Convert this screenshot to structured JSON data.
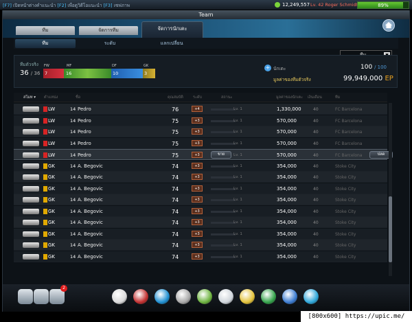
{
  "topbar": {
    "hint_k1": "[F7]",
    "hint_t1": "เปิดหน้าต่างคำแนะนำ",
    "hint_k2": "[F2]",
    "hint_t2": "เพื่อดูวิดีโอแนะนำ",
    "hint_k3": "[F3]",
    "hint_t3": "เซฟภาพ",
    "coins": "12,249,557",
    "level_name": "Lv. 42 Roger Schmidt",
    "progress_percent": 89,
    "progress_text": "89%"
  },
  "window": {
    "title": "Team"
  },
  "tabs": [
    {
      "label": "ทีม",
      "active": false
    },
    {
      "label": "จัดการทีม",
      "active": false
    },
    {
      "label": "จัดการนักเตะ",
      "active": true
    }
  ],
  "subtabs": [
    {
      "label": "ทีม",
      "active": true
    },
    {
      "label": "ระดับ",
      "active": false
    },
    {
      "label": "แลกเปลี่ยน",
      "active": false
    }
  ],
  "summary": {
    "label": "ทีมตัวจริง",
    "count": "36",
    "total": "/ 36",
    "fw_label": "FW",
    "fw": "7",
    "mf_label": "MF",
    "mf": "16",
    "df_label": "DF",
    "df": "10",
    "gk_label": "GK",
    "gk": "3",
    "capacity_label": "นักเตะ",
    "capacity": "100",
    "capacity_max": "/ 100",
    "value_label": "มูลค่าของทีมตัวจริง",
    "value": "99,949,000",
    "value_unit": "EP"
  },
  "filter": {
    "selected": "ทีม"
  },
  "columns": {
    "sort": "สโมท ▾",
    "position": "ตำแหน่ง",
    "name": "ชื่อ",
    "ovr": "คุณสมบัติ",
    "grade": "ระดับ",
    "status": "สถานะ",
    "price": "มูลค่าของนักเตะ",
    "salary": "เงินเดือน",
    "club": "ทีม"
  },
  "rows": [
    {
      "pos": "LW",
      "color": "#d72424",
      "num": "14",
      "name": "Pedro",
      "ovr": "76",
      "grade": "+4",
      "lv": "Lv. 1",
      "price": "1,330,000",
      "salary": "40",
      "club": "FC Barcelona",
      "sell": ""
    },
    {
      "pos": "LW",
      "color": "#d72424",
      "num": "14",
      "name": "Pedro",
      "ovr": "75",
      "grade": "+3",
      "lv": "Lv. 1",
      "price": "570,000",
      "salary": "40",
      "club": "FC Barcelona",
      "sell": ""
    },
    {
      "pos": "LW",
      "color": "#d72424",
      "num": "14",
      "name": "Pedro",
      "ovr": "75",
      "grade": "+3",
      "lv": "Lv. 1",
      "price": "570,000",
      "salary": "40",
      "club": "FC Barcelona",
      "sell": ""
    },
    {
      "pos": "LW",
      "color": "#d72424",
      "num": "14",
      "name": "Pedro",
      "ovr": "75",
      "grade": "+3",
      "lv": "Lv. 1",
      "price": "570,000",
      "salary": "40",
      "club": "FC Barcelona",
      "sell": ""
    },
    {
      "pos": "LW",
      "color": "#d72424",
      "num": "14",
      "name": "Pedro",
      "ovr": "75",
      "grade": "+3",
      "lv": "Lv. 1",
      "price": "570,000",
      "salary": "40",
      "club": "FC Barcelona",
      "sell": "ขาย",
      "release": "ปลด"
    },
    {
      "pos": "GK",
      "color": "#e0a800",
      "num": "14",
      "name": "A. Begovic",
      "ovr": "74",
      "grade": "+3",
      "lv": "Lv. 1",
      "price": "354,000",
      "salary": "40",
      "club": "Stoke City",
      "sell": ""
    },
    {
      "pos": "GK",
      "color": "#e0a800",
      "num": "14",
      "name": "A. Begovic",
      "ovr": "74",
      "grade": "+3",
      "lv": "Lv. 1",
      "price": "354,000",
      "salary": "40",
      "club": "Stoke City",
      "sell": ""
    },
    {
      "pos": "GK",
      "color": "#e0a800",
      "num": "14",
      "name": "A. Begovic",
      "ovr": "74",
      "grade": "+3",
      "lv": "Lv. 1",
      "price": "354,000",
      "salary": "40",
      "club": "Stoke City",
      "sell": ""
    },
    {
      "pos": "GK",
      "color": "#e0a800",
      "num": "14",
      "name": "A. Begovic",
      "ovr": "74",
      "grade": "+3",
      "lv": "Lv. 1",
      "price": "354,000",
      "salary": "40",
      "club": "Stoke City",
      "sell": ""
    },
    {
      "pos": "GK",
      "color": "#e0a800",
      "num": "14",
      "name": "A. Begovic",
      "ovr": "74",
      "grade": "+3",
      "lv": "Lv. 1",
      "price": "354,000",
      "salary": "40",
      "club": "Stoke City",
      "sell": ""
    },
    {
      "pos": "GK",
      "color": "#e0a800",
      "num": "14",
      "name": "A. Begovic",
      "ovr": "74",
      "grade": "+3",
      "lv": "Lv. 1",
      "price": "354,000",
      "salary": "40",
      "club": "Stoke City",
      "sell": ""
    },
    {
      "pos": "GK",
      "color": "#e0a800",
      "num": "14",
      "name": "A. Begovic",
      "ovr": "74",
      "grade": "+3",
      "lv": "Lv. 1",
      "price": "354,000",
      "salary": "40",
      "club": "Stoke City",
      "sell": ""
    },
    {
      "pos": "GK",
      "color": "#e0a800",
      "num": "14",
      "name": "A. Begovic",
      "ovr": "74",
      "grade": "+3",
      "lv": "Lv. 1",
      "price": "354,000",
      "salary": "40",
      "club": "Stoke City",
      "sell": ""
    },
    {
      "pos": "GK",
      "color": "#e0a800",
      "num": "14",
      "name": "A. Begovic",
      "ovr": "74",
      "grade": "+3",
      "lv": "Lv. 1",
      "price": "354,000",
      "salary": "40",
      "club": "Stoke City",
      "sell": ""
    }
  ],
  "dock": {
    "left_icons": [
      "profile-icon",
      "cards-icon",
      "mail-icon"
    ],
    "mail_badge": "2",
    "center_icons": [
      "whistle-icon",
      "ball-icon",
      "boots-icon",
      "trophy-icon",
      "level-up-icon",
      "document-icon",
      "coin-bag-icon",
      "badge-icon",
      "jersey-icon",
      "shop-cart-icon"
    ],
    "colors": [
      "#d9d9d9",
      "#c23030",
      "#1f8fd1",
      "#a8a8a8",
      "#6db33f",
      "#cfd5db",
      "#e3c23a",
      "#34a34b",
      "#3b7bd0",
      "#2ea6d9"
    ]
  },
  "watermark": "[800x600] https://upic.me/"
}
